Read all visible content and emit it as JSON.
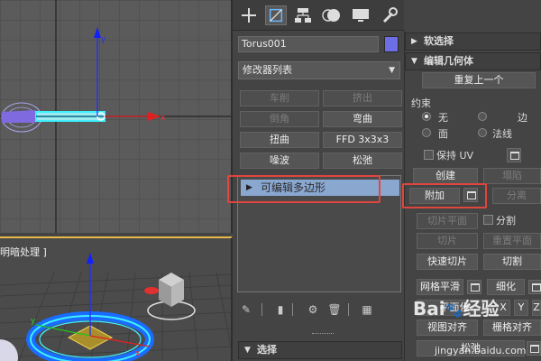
{
  "viewports": {
    "perspective_label": "明暗处理 ]"
  },
  "command_panel": {
    "tabs": [
      "create-icon",
      "modify-icon",
      "hierarchy-icon",
      "motion-icon",
      "display-icon",
      "utilities-icon"
    ],
    "object_name": "Torus001",
    "object_color": "#6d6ee6",
    "modifier_list": "修改器列表",
    "buttons": [
      {
        "label": "车削",
        "enabled": false
      },
      {
        "label": "挤出",
        "enabled": false
      },
      {
        "label": "倒角",
        "enabled": false
      },
      {
        "label": "弯曲",
        "enabled": true
      },
      {
        "label": "扭曲",
        "enabled": true
      },
      {
        "label": "FFD 3x3x3",
        "enabled": true
      },
      {
        "label": "噪波",
        "enabled": true
      },
      {
        "label": "松弛",
        "enabled": true
      }
    ],
    "stack_item": "可编辑多边形",
    "rollout_select": "选择"
  },
  "right_panel": {
    "soft_select": "软选择",
    "edit_geometry": "编辑几何体",
    "repeat_last": "重复上一个",
    "constraints_label": "约束",
    "constraints": [
      {
        "label": "无",
        "on": true
      },
      {
        "label": "边",
        "on": false
      },
      {
        "label": "面",
        "on": false
      },
      {
        "label": "法线",
        "on": false
      }
    ],
    "preserve_uv": "保持 UV",
    "create": "创建",
    "collapse": "塌陷",
    "attach": "附加",
    "detach": "分离",
    "slice_plane": "切片平面",
    "split": "分割",
    "slice": "切片",
    "reset_plane": "重置平面",
    "quickslice": "快速切片",
    "cut": "切割",
    "meshsmooth": "网格平滑",
    "tessellate": "细化",
    "make_planar": "平面化",
    "axes": [
      "X",
      "Y",
      "Z"
    ],
    "view_align": "视图对齐",
    "grid_align": "栅格对齐",
    "relax": "松弛"
  },
  "watermark": {
    "brand": "Bai",
    "brand2": "经验",
    "url": "jingyan.baidu.com"
  }
}
